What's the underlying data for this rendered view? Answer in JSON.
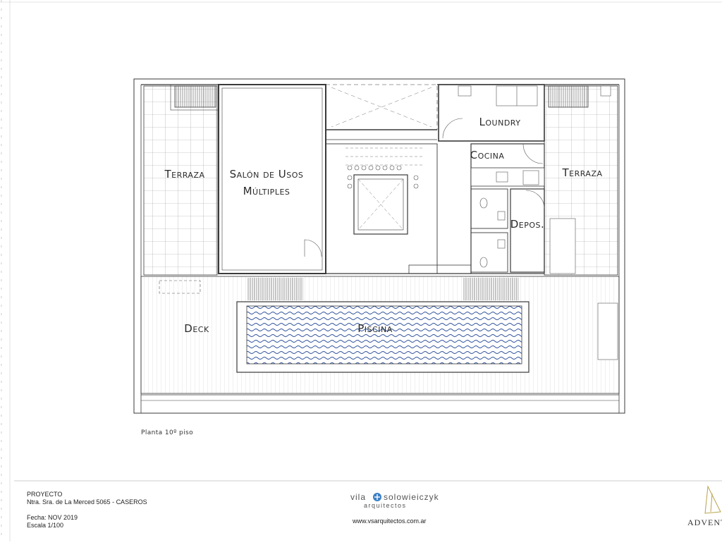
{
  "labels": {
    "terraza_left": "Terraza",
    "salon_line1": "Salón de Usos",
    "salon_line2": "Múltiples",
    "loundry": "Loundry",
    "cocina": "Cocina",
    "terraza_right": "Terraza",
    "depos": "Depos.",
    "deck": "Deck",
    "piscina": "Piscina"
  },
  "caption": "Planta 10º piso",
  "title_block": {
    "project_heading": "PROYECTO",
    "address": "Ntra. Sra. de La Merced 5065 - CASEROS",
    "date": "Fecha: NOV 2019",
    "scale": "Escala 1/100"
  },
  "brand": {
    "name_left": "vila",
    "name_right": "solowieiczyk",
    "subtitle": "arquitectos",
    "url": "www.vsarquitectos.com.ar",
    "partner": "ADVENT"
  },
  "colors": {
    "line": "#3a3a3a",
    "grid": "#8a8a8a",
    "pool_wave": "#2c4f9a",
    "brand_dot": "#3b7fc4"
  }
}
